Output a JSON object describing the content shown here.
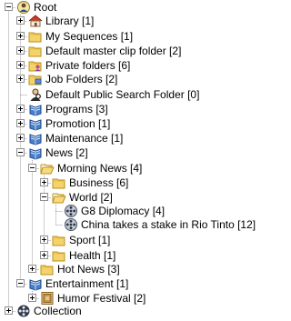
{
  "tree": {
    "nodes": [
      {
        "label": "Root",
        "icon": "root-user-icon",
        "expanded": true
      },
      {
        "label": "Library [1]",
        "icon": "library-house-icon",
        "expanded": false
      },
      {
        "label": "My Sequences [1]",
        "icon": "folder-icon",
        "expanded": false
      },
      {
        "label": "Default master clip folder [2]",
        "icon": "folder-icon",
        "expanded": false
      },
      {
        "label": "Private folders [6]",
        "icon": "private-folder-icon",
        "expanded": false
      },
      {
        "label": "Job Folders [2]",
        "icon": "job-folder-icon",
        "expanded": false
      },
      {
        "label": "Default Public Search Folder [0]",
        "icon": "search-user-icon",
        "expanded": null
      },
      {
        "label": "Programs [3]",
        "icon": "programs-icon",
        "expanded": false
      },
      {
        "label": "Promotion [1]",
        "icon": "programs-icon",
        "expanded": false
      },
      {
        "label": "Maintenance [1]",
        "icon": "programs-icon",
        "expanded": false
      },
      {
        "label": "News [2]",
        "icon": "programs-icon",
        "expanded": true
      },
      {
        "label": "Morning News [4]",
        "icon": "open-folder-icon",
        "expanded": true
      },
      {
        "label": "Business [6]",
        "icon": "folder-icon",
        "expanded": false
      },
      {
        "label": "World [2]",
        "icon": "open-folder-icon",
        "expanded": true
      },
      {
        "label": "G8 Diplomacy [4]",
        "icon": "film-reel-icon",
        "expanded": null
      },
      {
        "label": "China takes a stake in Rio Tinto [12]",
        "icon": "film-reel-icon",
        "expanded": null
      },
      {
        "label": "Sport [1]",
        "icon": "folder-icon",
        "expanded": false
      },
      {
        "label": "Health [1]",
        "icon": "folder-icon",
        "expanded": false
      },
      {
        "label": "Hot News [3]",
        "icon": "folder-icon",
        "expanded": false
      },
      {
        "label": "Entertainment [1]",
        "icon": "programs-icon",
        "expanded": true
      },
      {
        "label": "Humor Festival [2]",
        "icon": "humor-festival-icon",
        "expanded": false
      },
      {
        "label": "Collection",
        "icon": "collection-reel-icon",
        "expanded": false
      }
    ]
  }
}
